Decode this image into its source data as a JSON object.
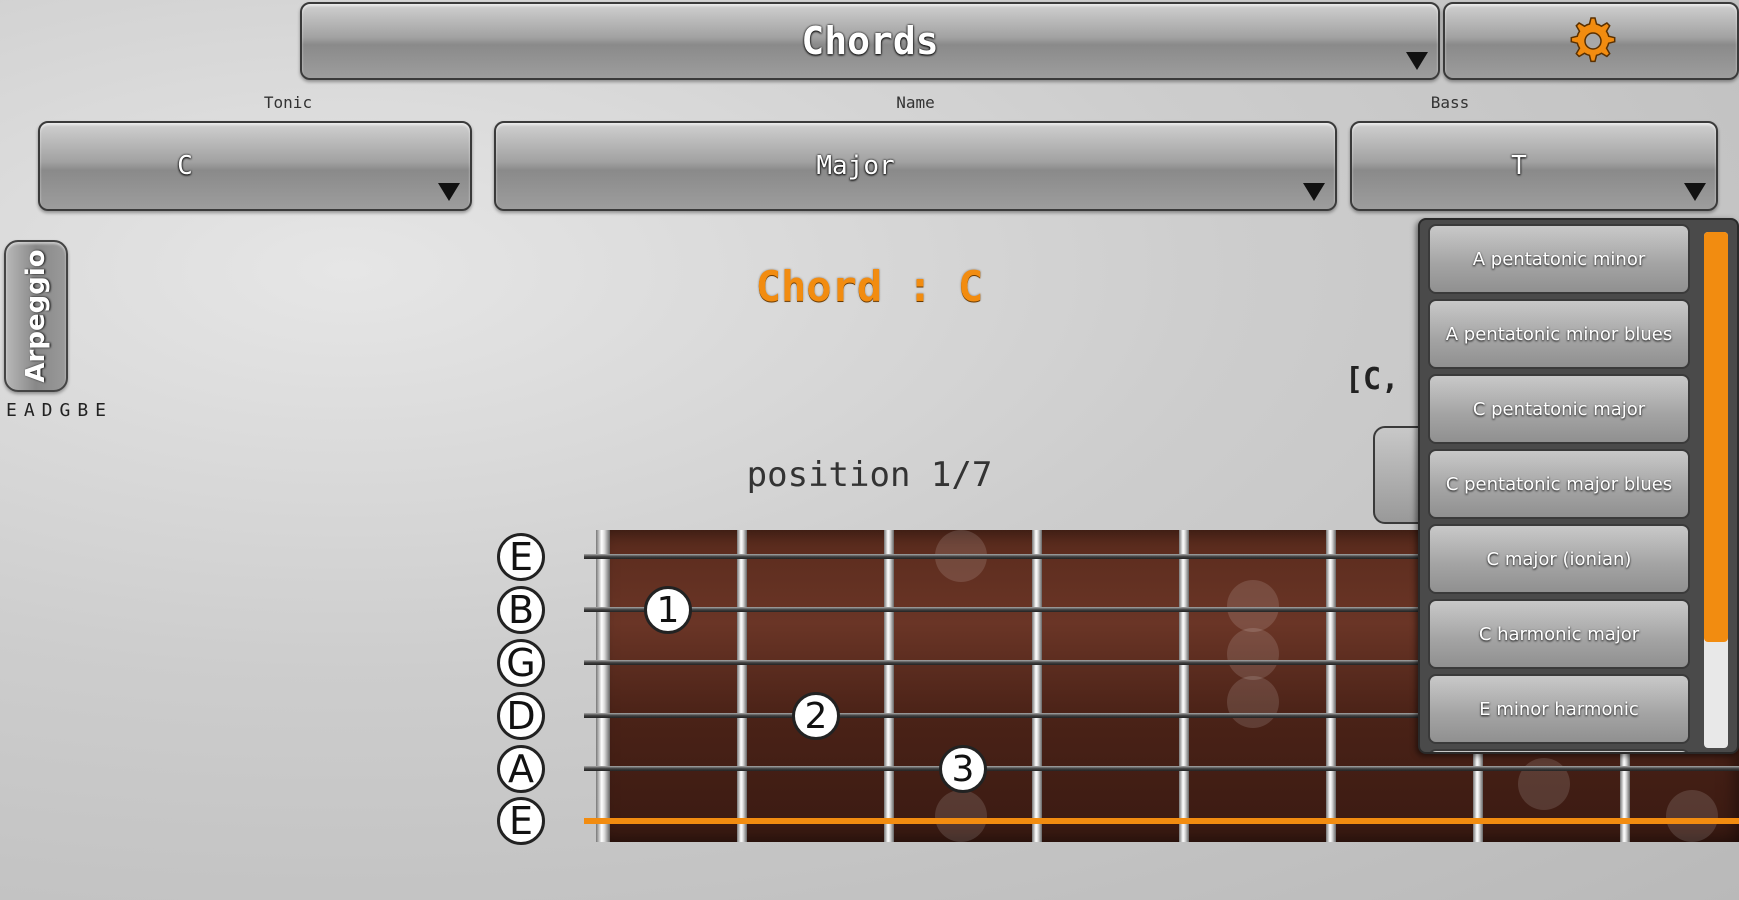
{
  "header": {
    "mode_label": "Chords",
    "settings_icon": "gear-icon",
    "accent_color": "#f28c10"
  },
  "selectors": {
    "tonic": {
      "label": "Tonic",
      "value": "C"
    },
    "name": {
      "label": "Name",
      "value": "Major"
    },
    "bass": {
      "label": "Bass",
      "value": "T"
    }
  },
  "arpeggio_label": "Arpeggio",
  "tuning": "EADGBE",
  "chord_title": "Chord : C",
  "notes_partial": "[C, E",
  "position_text": "position 1/7",
  "strings": [
    "E",
    "B",
    "G",
    "D",
    "A",
    "E"
  ],
  "fingers": [
    {
      "label": "1",
      "string": "B",
      "fret": 1
    },
    {
      "label": "2",
      "string": "D",
      "fret": 2
    },
    {
      "label": "3",
      "string": "A",
      "fret": 3
    }
  ],
  "scale_list": [
    "A pentatonic minor",
    "A pentatonic minor blues",
    "C pentatonic major",
    "C pentatonic major blues",
    "C major (ionian)",
    "C harmonic major",
    "E minor harmonic"
  ]
}
